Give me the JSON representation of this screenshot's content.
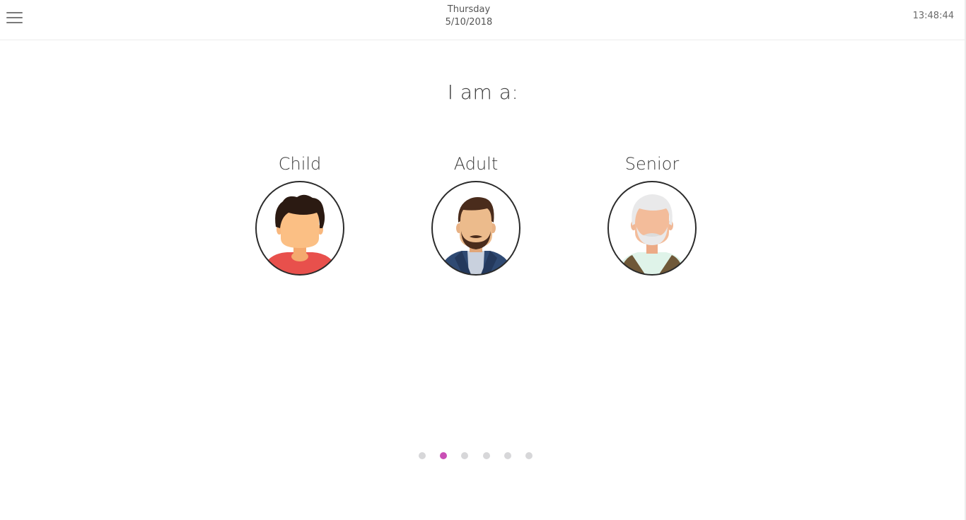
{
  "header": {
    "menu_icon": "hamburger-menu-icon",
    "day": "Thursday",
    "date": "5/10/2018",
    "time": "13:48:44"
  },
  "main": {
    "title": "I am a:",
    "options": [
      {
        "label": "Child",
        "icon": "child-avatar-icon"
      },
      {
        "label": "Adult",
        "icon": "adult-avatar-icon"
      },
      {
        "label": "Senior",
        "icon": "senior-avatar-icon"
      }
    ]
  },
  "pager": {
    "count": 6,
    "active_index": 1,
    "active_color": "#c94fb5",
    "inactive_color": "#d7d7d9"
  }
}
